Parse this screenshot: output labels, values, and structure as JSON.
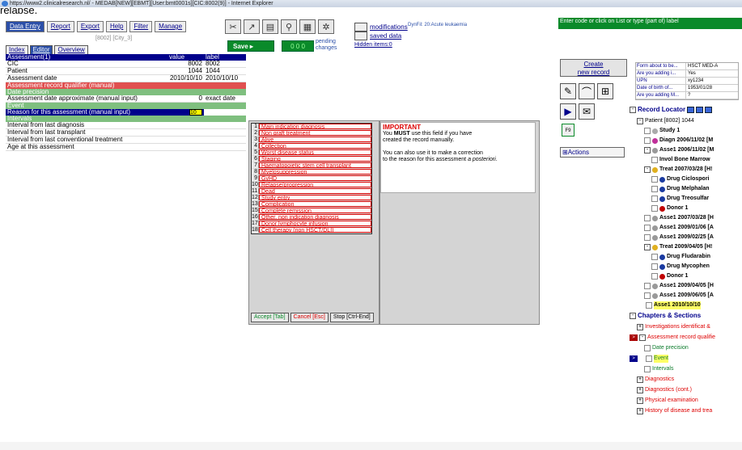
{
  "caption": "relapse.",
  "window": {
    "title": "https://www2.clinicalresearch.nl/ - MEDAB[NEW][EBMT][User:bmt0001s][CIC:8002(9)] - Internet Explorer"
  },
  "menu": [
    "Data Entry",
    "Report",
    "Export",
    "Help",
    "Filter",
    "Manage"
  ],
  "context_line": "[8002] [City_3]",
  "tabs": [
    "Index",
    "Editor",
    "Overview"
  ],
  "toolbar": {
    "save_label": "Save",
    "pending": "0 0 0",
    "pending_text": "pending\nchanges",
    "modifications": "modifications",
    "saved_data": "saved data",
    "hidden_items": "Hidden items:0",
    "dynfil": "DynFil: 20:Acute leukaemia"
  },
  "right_banner": "Enter code or click on List or type (part of) label",
  "assessment": {
    "header": {
      "label": "Assessment(1)",
      "col1": "value",
      "col2": "label"
    },
    "rows": [
      {
        "label": "CIC",
        "value": "8002",
        "text": "8002",
        "style": "plain"
      },
      {
        "label": "Patient",
        "value": "1044",
        "text": "1044",
        "style": "plain"
      },
      {
        "label": "Assessment date",
        "value": "2010/10/10",
        "text": "2010/10/10",
        "style": "plain"
      },
      {
        "label": "Assessment record qualifier (manual)",
        "value": "",
        "text": "",
        "style": "red"
      },
      {
        "label": "Date precision",
        "value": "",
        "text": "",
        "style": "green"
      },
      {
        "label": "Assessment date approximate (manual input)",
        "value": "0",
        "text": "exact date",
        "style": "plain"
      },
      {
        "label": "Event",
        "value": "",
        "text": "",
        "style": "green"
      },
      {
        "label": "Reason for this assessment (manual input)",
        "value": "10",
        "text": "",
        "style": "sel"
      },
      {
        "label": "Intervals",
        "value": "",
        "text": "",
        "style": "green"
      },
      {
        "label": "Interval from last diagnosis",
        "value": "",
        "text": "",
        "style": "plain"
      },
      {
        "label": "Interval from last transplant",
        "value": "",
        "text": "",
        "style": "plain"
      },
      {
        "label": "Interval from last conventional treatment",
        "value": "",
        "text": "",
        "style": "plain"
      },
      {
        "label": "Age at this assessment",
        "value": "",
        "text": "",
        "style": "plain"
      }
    ]
  },
  "dropdown": {
    "items": [
      {
        "n": "1",
        "t": "Main indication diagnosis"
      },
      {
        "n": "2",
        "t": "Non graft treatment"
      },
      {
        "n": "3",
        "t": "Alive"
      },
      {
        "n": "4",
        "t": "Collection"
      },
      {
        "n": "5",
        "t": "Worst disease status"
      },
      {
        "n": "6",
        "t": "Staging"
      },
      {
        "n": "7",
        "t": "Haematopoietic stem cell transplant"
      },
      {
        "n": "8",
        "t": "Myelosuppression"
      },
      {
        "n": "9",
        "t": "GvHD"
      },
      {
        "n": "10",
        "t": "Relapse/progression"
      },
      {
        "n": "11",
        "t": "Dead"
      },
      {
        "n": "12",
        "t": "Study entry"
      },
      {
        "n": "13",
        "t": "Complication"
      },
      {
        "n": "15",
        "t": "Complete remission"
      },
      {
        "n": "16",
        "t": "Other, non indication diagnosis"
      },
      {
        "n": "17",
        "t": "Donor lymphocyte infusion"
      },
      {
        "n": "18",
        "t": "Cell therapy (non HSCT/DLI)"
      }
    ],
    "accept": "Accept [Tab]",
    "cancel": "Cancel [Esc]",
    "stop": "Stop [Ctrl-End]"
  },
  "important": {
    "title": "IMPORTANT",
    "line1a": "You ",
    "must": "MUST",
    "line1b": " use this field if you have",
    "line2": "created the record manually.",
    "line3": "You can also use it to make a correction",
    "line4a": "to the reason for this assessment ",
    "line4b": "a posteriori",
    "line4c": "."
  },
  "create_record": "Create\nnew record",
  "actions": "Actions",
  "f9": "F9",
  "form_info": [
    {
      "k": "Form about to be...",
      "v": "HSCT MED-A"
    },
    {
      "k": "Are you adding i...",
      "v": "Yes"
    },
    {
      "k": "UPN",
      "v": "xy1234"
    },
    {
      "k": "Date of birth of...",
      "v": "1953/01/28"
    },
    {
      "k": "Are you adding M...",
      "v": "?"
    }
  ],
  "record_locator": {
    "title": "Record Locator",
    "items": [
      {
        "text": "Patient [8002] 1044",
        "indent": 1,
        "kind": "exp",
        "icon": ""
      },
      {
        "text": "Study 1",
        "indent": 2,
        "kind": "chk",
        "icon": "#aaaaaa"
      },
      {
        "text": "Diagn 2006/11/02 [M",
        "indent": 2,
        "kind": "chk",
        "icon": "#c0309a"
      },
      {
        "text": "Asse1 2006/11/02 [M",
        "indent": 2,
        "kind": "exp",
        "icon": "#999999"
      },
      {
        "text": "Invol Bone Marrow",
        "indent": 3,
        "kind": "chk",
        "icon": ""
      },
      {
        "text": "Treat 2007/03/28 [H!",
        "indent": 2,
        "kind": "exp",
        "icon": "#e0b020"
      },
      {
        "text": "Drug Ciclospori",
        "indent": 3,
        "kind": "chk",
        "icon": "#1a3aa0"
      },
      {
        "text": "Drug Melphalan",
        "indent": 3,
        "kind": "chk",
        "icon": "#1a3aa0"
      },
      {
        "text": "Drug Treosulfar",
        "indent": 3,
        "kind": "chk",
        "icon": "#1a3aa0"
      },
      {
        "text": "Donor 1",
        "indent": 3,
        "kind": "chk",
        "icon": "#c00000"
      },
      {
        "text": "Asse1 2007/03/28 [H",
        "indent": 2,
        "kind": "chk",
        "icon": "#999999"
      },
      {
        "text": "Asse1 2009/01/06 [A",
        "indent": 2,
        "kind": "chk",
        "icon": "#999999"
      },
      {
        "text": "Asse1 2009/02/25 [A",
        "indent": 2,
        "kind": "chk",
        "icon": "#999999"
      },
      {
        "text": "Treat 2009/04/05 [H!",
        "indent": 2,
        "kind": "exp",
        "icon": "#e0b020"
      },
      {
        "text": "Drug Fludarabin",
        "indent": 3,
        "kind": "chk",
        "icon": "#1a3aa0"
      },
      {
        "text": "Drug Mycophen",
        "indent": 3,
        "kind": "chk",
        "icon": "#1a3aa0"
      },
      {
        "text": "Donor 1",
        "indent": 3,
        "kind": "chk",
        "icon": "#c00000"
      },
      {
        "text": "Asse1 2009/04/05 [H",
        "indent": 2,
        "kind": "chk",
        "icon": "#999999"
      },
      {
        "text": "Asse1 2009/06/05 [A",
        "indent": 2,
        "kind": "chk",
        "icon": "#999999"
      },
      {
        "text": "Asse1 2010/10/10",
        "indent": 2,
        "kind": "cur",
        "icon": ""
      }
    ]
  },
  "chapters": {
    "title": "Chapters & Sections",
    "items": [
      {
        "text": "Investigations identificat &",
        "indent": 1,
        "kind": "exp+",
        "color": "red",
        "mark": ""
      },
      {
        "text": "Assessment record qualifie",
        "indent": 1,
        "kind": "exp-",
        "color": "red",
        "mark": "r"
      },
      {
        "text": "Date precision",
        "indent": 2,
        "kind": "chk",
        "color": "green",
        "mark": ""
      },
      {
        "text": "Event",
        "indent": 2,
        "kind": "chk",
        "color": "green",
        "mark": "b"
      },
      {
        "text": "Intervals",
        "indent": 2,
        "kind": "chk",
        "color": "green",
        "mark": ""
      },
      {
        "text": "Diagnostics",
        "indent": 1,
        "kind": "exp+",
        "color": "red",
        "mark": ""
      },
      {
        "text": "Diagnostics (cont.)",
        "indent": 1,
        "kind": "exp+",
        "color": "red",
        "mark": ""
      },
      {
        "text": "Physical examination",
        "indent": 1,
        "kind": "exp+",
        "color": "red",
        "mark": ""
      },
      {
        "text": "History of disease and trea",
        "indent": 1,
        "kind": "exp+",
        "color": "red",
        "mark": ""
      }
    ]
  }
}
